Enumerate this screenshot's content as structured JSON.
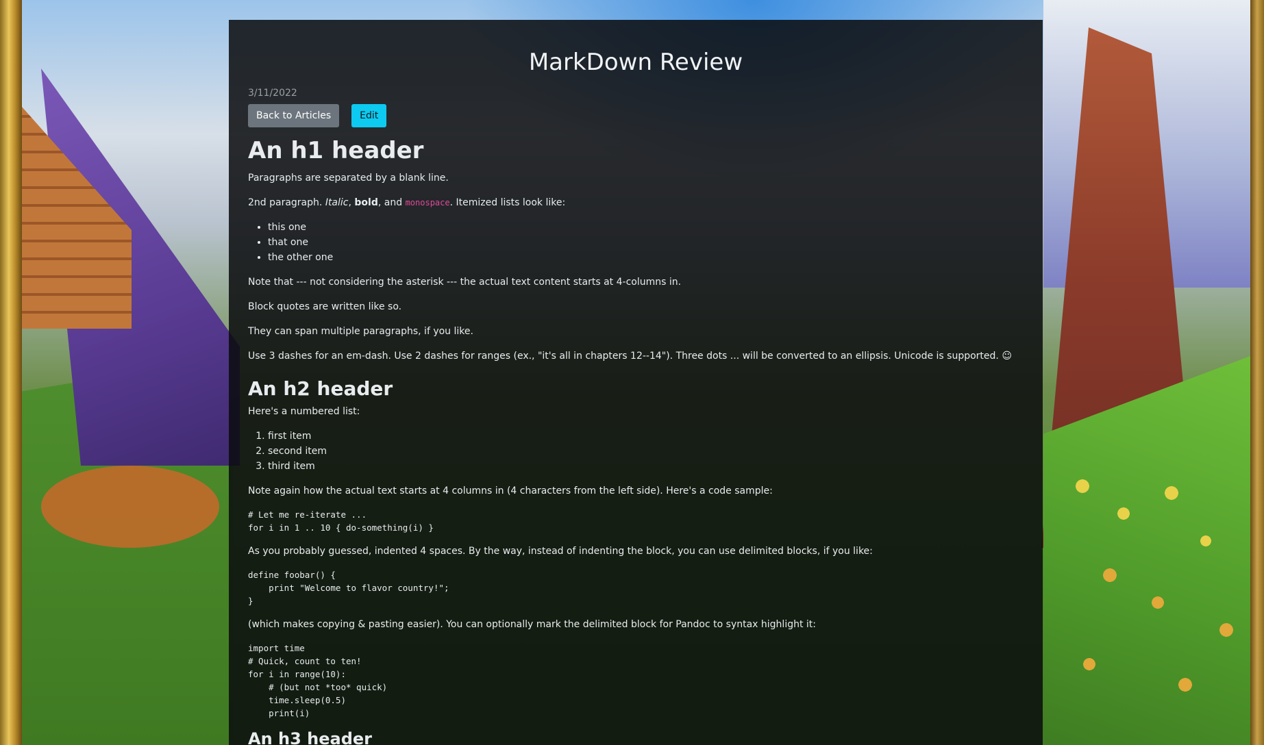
{
  "article": {
    "title": "MarkDown Review",
    "date": "3/11/2022",
    "buttons": {
      "back_label": "Back to Articles",
      "edit_label": "Edit"
    }
  },
  "content": {
    "h1": "An h1 header",
    "p1": "Paragraphs are separated by a blank line.",
    "p2": {
      "prefix": "2nd paragraph. ",
      "italic": "Italic",
      "sep1": ", ",
      "bold": "bold",
      "sep2": ", and ",
      "code": "monospace",
      "suffix": ". Itemized lists look like:"
    },
    "bullets": [
      "this one",
      "that one",
      "the other one"
    ],
    "p3": "Note that --- not considering the asterisk --- the actual text content starts at 4-columns in.",
    "p4": "Block quotes are written like so.",
    "p5": "They can span multiple paragraphs, if you like.",
    "p6": "Use 3 dashes for an em-dash. Use 2 dashes for ranges (ex., \"it's all in chapters 12--14\"). Three dots ... will be converted to an ellipsis. Unicode is supported. ☺",
    "h2": "An h2 header",
    "p7": "Here's a numbered list:",
    "numbered": [
      "first item",
      "second item",
      "third item"
    ],
    "p8": "Note again how the actual text starts at 4 columns in (4 characters from the left side). Here's a code sample:",
    "code1": "# Let me re-iterate ...\nfor i in 1 .. 10 { do-something(i) }",
    "p9": "As you probably guessed, indented 4 spaces. By the way, instead of indenting the block, you can use delimited blocks, if you like:",
    "code2": "define foobar() {\n    print \"Welcome to flavor country!\";\n}",
    "p10": "(which makes copying & pasting easier). You can optionally mark the delimited block for Pandoc to syntax highlight it:",
    "code3": "import time\n# Quick, count to ten!\nfor i in range(10):\n    # (but not *too* quick)\n    time.sleep(0.5)\n    print(i)",
    "h3": "An h3 header"
  }
}
